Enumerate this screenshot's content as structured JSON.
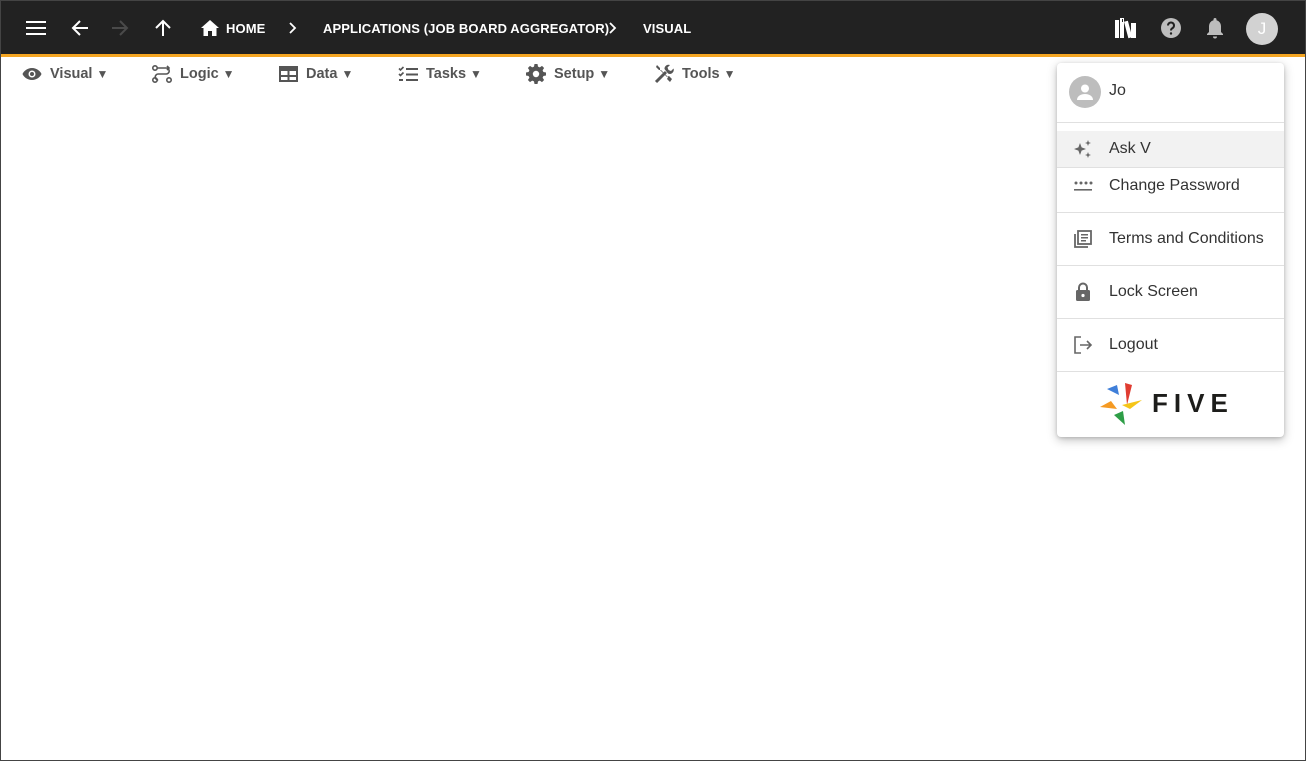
{
  "topbar": {
    "breadcrumbs": [
      {
        "label": "HOME"
      },
      {
        "label": "APPLICATIONS (JOB BOARD AGGREGATOR)"
      },
      {
        "label": "VISUAL"
      }
    ],
    "avatar_initial": "J",
    "icons": [
      "menu-icon",
      "back-arrow-icon",
      "forward-arrow-icon",
      "up-arrow-icon",
      "home-icon",
      "library-icon",
      "help-icon",
      "bell-icon"
    ],
    "accent_color": "#f5a623",
    "background_color": "#222222"
  },
  "menubar": {
    "items": [
      {
        "label": "Visual",
        "icon": "eye-icon"
      },
      {
        "label": "Logic",
        "icon": "logic-flow-icon"
      },
      {
        "label": "Data",
        "icon": "table-icon"
      },
      {
        "label": "Tasks",
        "icon": "checklist-icon"
      },
      {
        "label": "Setup",
        "icon": "gear-icon"
      },
      {
        "label": "Tools",
        "icon": "tools-icon"
      }
    ],
    "caret": "▼"
  },
  "user_menu": {
    "user_name": "Jo",
    "items": [
      {
        "label": "Ask V",
        "icon": "sparkle-icon"
      },
      {
        "label": "Change Password",
        "icon": "password-icon"
      },
      {
        "label": "Terms and Conditions",
        "icon": "document-icon"
      },
      {
        "label": "Lock Screen",
        "icon": "lock-icon"
      },
      {
        "label": "Logout",
        "icon": "logout-icon"
      }
    ],
    "logo_text": "FIVE"
  }
}
